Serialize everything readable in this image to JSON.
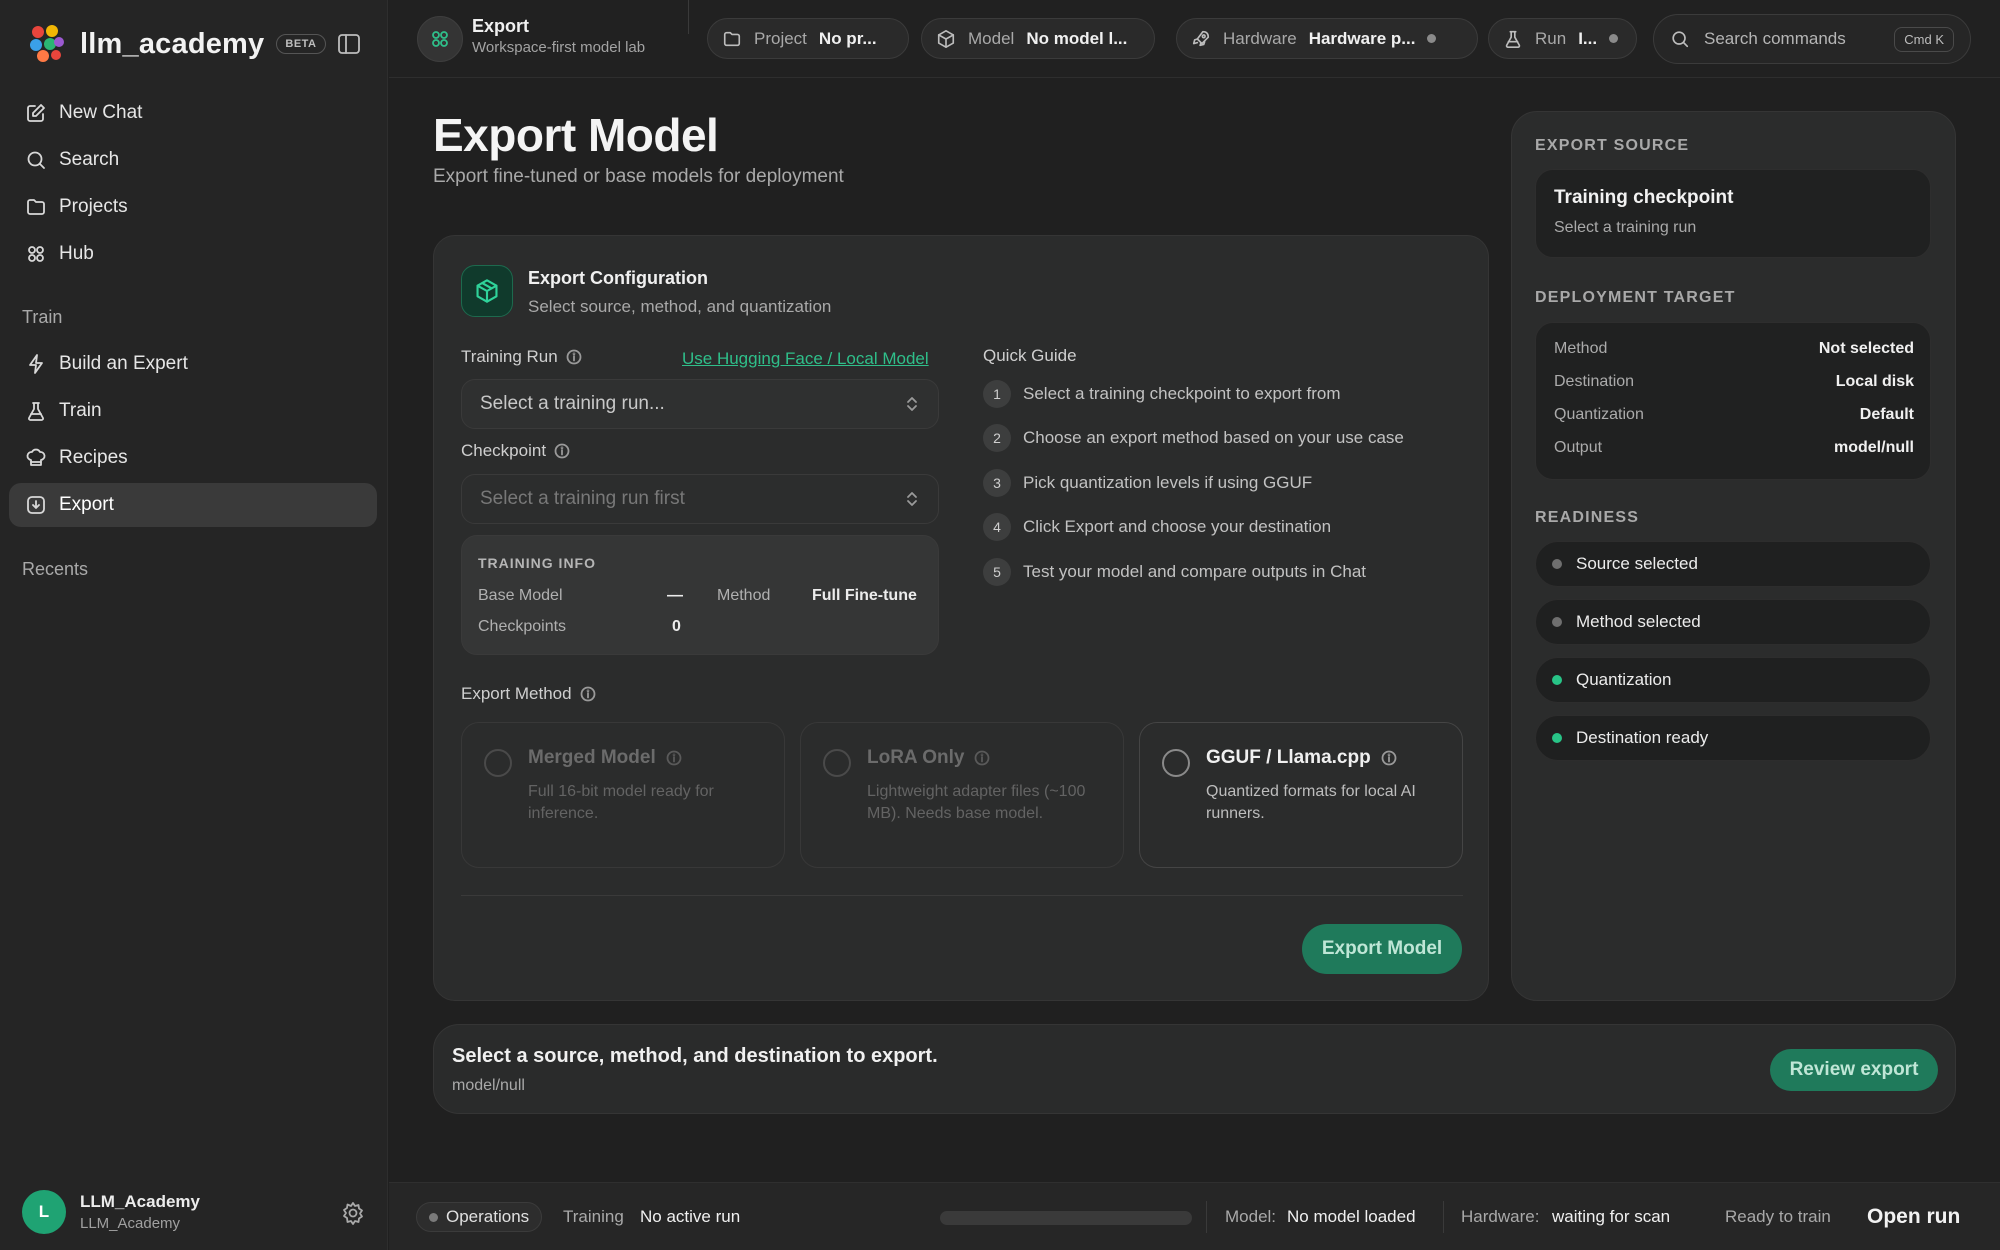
{
  "app": {
    "name": "llm_academy",
    "badge": "BETA"
  },
  "sidebar": {
    "primary": [
      {
        "label": "New Chat",
        "icon": "edit-icon"
      },
      {
        "label": "Search",
        "icon": "search-icon"
      },
      {
        "label": "Projects",
        "icon": "folder-icon"
      },
      {
        "label": "Hub",
        "icon": "grid-icon"
      }
    ],
    "train_section": "Train",
    "train": [
      {
        "label": "Build an Expert",
        "icon": "bolt-icon"
      },
      {
        "label": "Train",
        "icon": "flask-icon"
      },
      {
        "label": "Recipes",
        "icon": "chef-hat-icon"
      },
      {
        "label": "Export",
        "icon": "download-icon",
        "active": true
      }
    ],
    "recents_label": "Recents",
    "user": {
      "initial": "L",
      "name": "LLM_Academy",
      "handle": "LLM_Academy"
    }
  },
  "topbar": {
    "crumb_title": "Export",
    "crumb_subtitle": "Workspace-first model lab",
    "pills": {
      "project": {
        "key": "Project",
        "value": "No pr..."
      },
      "model": {
        "key": "Model",
        "value": "No model l..."
      },
      "hardware": {
        "key": "Hardware",
        "value": "Hardware p..."
      },
      "run": {
        "key": "Run",
        "value": "I..."
      }
    },
    "search_placeholder": "Search commands",
    "search_shortcut": "Cmd K"
  },
  "page": {
    "title": "Export Model",
    "subtitle": "Export fine-tuned or base models for deployment"
  },
  "config": {
    "title": "Export Configuration",
    "subtitle": "Select source, method, and quantization",
    "training_run_label": "Training Run",
    "hf_link": "Use Hugging Face / Local Model",
    "training_run_placeholder": "Select a training run...",
    "checkpoint_label": "Checkpoint",
    "checkpoint_placeholder": "Select a training run first",
    "training_info": {
      "title": "TRAINING INFO",
      "base_model_label": "Base Model",
      "base_model_value": "—",
      "method_label": "Method",
      "method_value": "Full Fine-tune",
      "checkpoints_label": "Checkpoints",
      "checkpoints_value": "0"
    },
    "quick_guide_title": "Quick Guide",
    "quick_guide": [
      {
        "n": "1",
        "text": "Select a training checkpoint to export from"
      },
      {
        "n": "2",
        "text": "Choose an export method based on your use case"
      },
      {
        "n": "3",
        "text": "Pick quantization levels if using GGUF"
      },
      {
        "n": "4",
        "text": "Click Export and choose your destination"
      },
      {
        "n": "5",
        "text": "Test your model and compare outputs in Chat"
      }
    ],
    "export_method_label": "Export Method",
    "methods": [
      {
        "title": "Merged Model",
        "desc": "Full 16-bit model ready for inference."
      },
      {
        "title": "LoRA Only",
        "desc": "Lightweight adapter files (~100 MB). Needs base model."
      },
      {
        "title": "GGUF / Llama.cpp",
        "desc": "Quantized formats for local AI runners."
      }
    ],
    "export_button": "Export Model"
  },
  "right_panel": {
    "source_label": "EXPORT SOURCE",
    "source_title": "Training checkpoint",
    "source_subtitle": "Select a training run",
    "target_label": "DEPLOYMENT TARGET",
    "target": [
      {
        "k": "Method",
        "v": "Not selected"
      },
      {
        "k": "Destination",
        "v": "Local disk"
      },
      {
        "k": "Quantization",
        "v": "Default"
      },
      {
        "k": "Output",
        "v": "model/null"
      }
    ],
    "readiness_label": "READINESS",
    "readiness": [
      {
        "label": "Source selected",
        "ok": false
      },
      {
        "label": "Method selected",
        "ok": false
      },
      {
        "label": "Quantization",
        "ok": true
      },
      {
        "label": "Destination ready",
        "ok": true
      }
    ]
  },
  "action_bar": {
    "title": "Select a source, method, and destination to export.",
    "subtitle": "model/null",
    "button": "Review export"
  },
  "statusbar": {
    "operations": "Operations",
    "training_label": "Training",
    "training_value": "No active run",
    "model_label": "Model:",
    "model_value": "No model loaded",
    "hardware_label": "Hardware:",
    "hardware_value": "waiting for scan",
    "ready_text": "Ready to train",
    "open_run": "Open run"
  },
  "colors": {
    "accent": "#2fbf8a",
    "button": "#1f7a5b",
    "ok_dot": "#28c487"
  }
}
